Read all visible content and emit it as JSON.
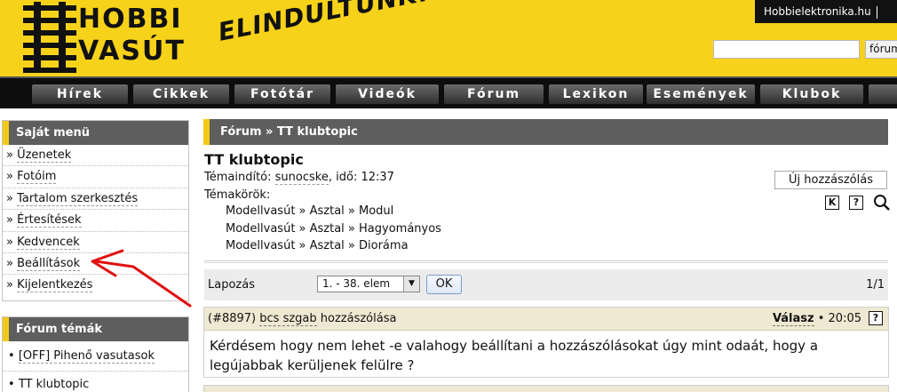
{
  "header": {
    "logo_line1": "HOBBI",
    "logo_line2": "VASÚT",
    "slogan": "ELINDULTUNK!",
    "site_link": "Hobbielektronika.hu",
    "search_placeholder": "",
    "search_button": "fórum"
  },
  "nav": {
    "items": [
      "Hírek",
      "Cikkek",
      "Fotótár",
      "Videók",
      "Fórum",
      "Lexikon",
      "Események",
      "Klubok"
    ]
  },
  "sidebar": {
    "own_menu_title": "Saját menü",
    "own_menu_items": [
      "Üzenetek",
      "Fotóim",
      "Tartalom szerkesztés",
      "Értesítések",
      "Kedvencek",
      "Beállítások",
      "Kijelentkezés"
    ],
    "forum_topics_title": "Fórum témák",
    "forum_topics": [
      "[OFF] Pihenő vasutasok",
      "TT klubtopic"
    ]
  },
  "breadcrumb": "Fórum » TT klubtopic",
  "topic": {
    "title": "TT klubtopic",
    "starter_label": "Témaindító:",
    "starter_user": "sunocske",
    "starter_time": ", idő: 12:37",
    "categories_label": "Témakörök:",
    "categories": [
      "Modellvasút » Asztal » Modul",
      "Modellvasút » Asztal » Hagyományos",
      "Modellvasút » Asztal » Dioráma"
    ],
    "new_post_button": "Új hozzászólás",
    "icon_k": "K",
    "icon_help": "?"
  },
  "pager": {
    "label": "Lapozás",
    "selected": "1. - 38. elem",
    "ok_button": "OK",
    "page_count": "1/1"
  },
  "posts": [
    {
      "id": "(#8897)",
      "author": "bcs szgab",
      "suffix": "hozzászólása",
      "reply": "Válasz",
      "time": "• 20:05",
      "body": "Kérdésem hogy nem lehet -e valahogy beállítani a hozzászólásokat úgy mint odaát, hogy a legújabbak kerüljenek felülre ?"
    }
  ],
  "colors": {
    "header_yellow": "#f7d21a",
    "accent_yellow": "#f3c919",
    "box_head_gray": "#5e5e5e",
    "annotation_red": "#e01010"
  },
  "icons": [
    "help-icon",
    "k-icon",
    "zoom-icon",
    "dropdown-arrow-icon"
  ]
}
